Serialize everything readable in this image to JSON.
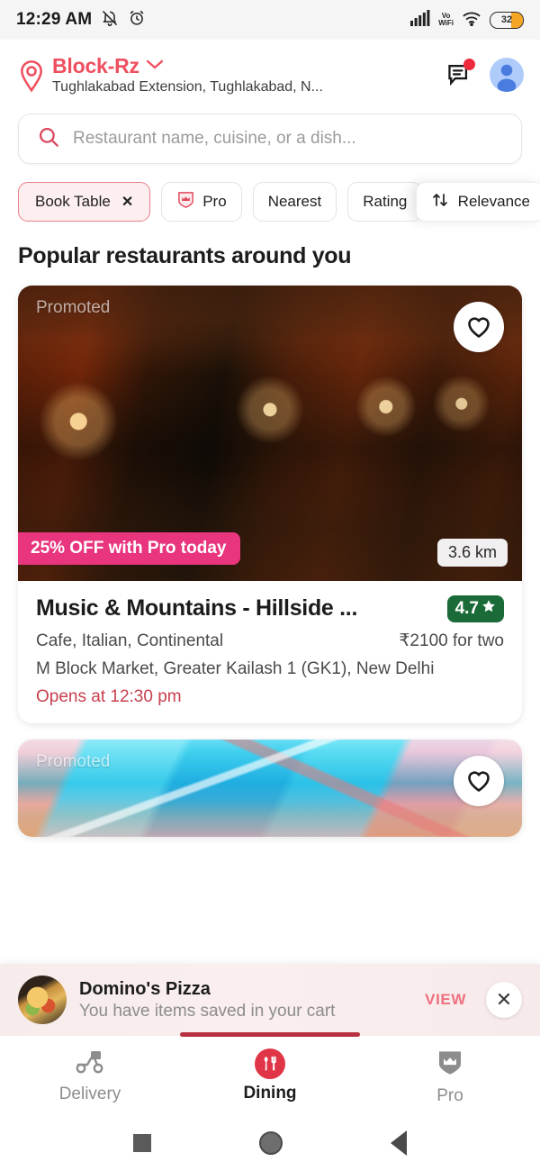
{
  "status_bar": {
    "time": "12:29 AM",
    "bell_icon": "bell-muted-icon",
    "alarm_icon": "alarm-clock-icon",
    "signal_icon": "signal-bars-icon",
    "vowifi_line1": "Vo",
    "vowifi_line2": "WiFi",
    "wifi_icon": "wifi-icon",
    "battery_percent": "32"
  },
  "header": {
    "location_icon": "location-pin-icon",
    "location_title": "Block-Rz",
    "chevron_icon": "chevron-down-icon",
    "location_subtitle": "Tughlakabad Extension, Tughlakabad, N...",
    "inbox_icon": "inbox-icon",
    "notification_badge": "",
    "avatar_icon": "user-avatar-icon"
  },
  "search": {
    "icon": "search-icon",
    "placeholder": "Restaurant name, cuisine, or a dish..."
  },
  "filters": {
    "chips": [
      {
        "label": "Book Table",
        "active": true,
        "close": "✕"
      },
      {
        "label": "Pro",
        "active": false,
        "icon": "pro-crown-shield-icon"
      },
      {
        "label": "Nearest",
        "active": false
      },
      {
        "label": "Rating",
        "active": false
      }
    ],
    "sort": {
      "icon": "sort-updown-icon",
      "label": "Relevance"
    }
  },
  "main": {
    "section_title": "Popular restaurants around you",
    "restaurants": [
      {
        "promoted_label": "Promoted",
        "favorite_icon": "heart-outline-icon",
        "offer": "25% OFF with Pro today",
        "distance": "3.6 km",
        "name": "Music & Mountains - Hillside ...",
        "rating": "4.7",
        "star_icon": "star-icon",
        "cuisine": "Cafe, Italian, Continental",
        "cost": "₹2100 for two",
        "address": "M Block Market, Greater Kailash 1 (GK1), New Delhi",
        "timing": "Opens at 12:30 pm"
      },
      {
        "promoted_label": "Promoted",
        "favorite_icon": "heart-outline-icon"
      }
    ]
  },
  "cart_strip": {
    "thumbnail_icon": "restaurant-thumbnail",
    "title": "Domino's Pizza",
    "subtitle": "You have items saved in your cart",
    "view_label": "VIEW",
    "close_label": "✕"
  },
  "bottom_nav": {
    "items": [
      {
        "label": "Delivery",
        "icon": "scooter-delivery-icon",
        "active": false
      },
      {
        "label": "Dining",
        "icon": "fork-spoon-icon",
        "active": true
      },
      {
        "label": "Pro",
        "icon": "crown-shield-icon",
        "active": false
      }
    ]
  },
  "system_nav": {
    "recents_icon": "square-recents-icon",
    "home_icon": "circle-home-icon",
    "back_icon": "triangle-back-icon"
  },
  "colors": {
    "brand_red": "#ef4f5f",
    "offer_pink": "#e8357e",
    "rating_green": "#1b6b38",
    "battery_amber": "#f5a623",
    "tab_indicator": "#b8303f"
  }
}
